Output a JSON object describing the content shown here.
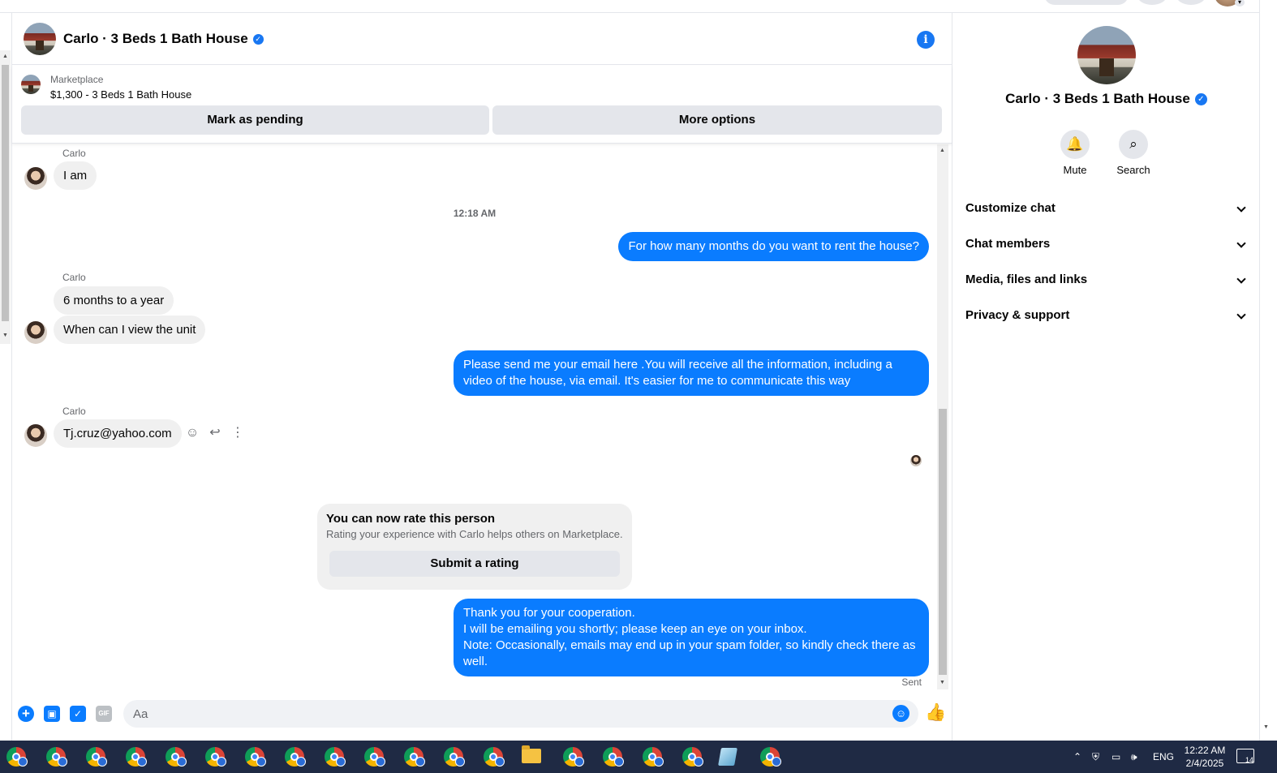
{
  "chat": {
    "title": "Carlo · 3 Beds 1 Bath House",
    "marketplace_label": "Marketplace",
    "listing": "$1,300 - 3 Beds 1 Bath House",
    "mark_pending": "Mark as pending",
    "more_options": "More options"
  },
  "messages": {
    "sender": "Carlo",
    "m1": "I am",
    "time": "12:18 AM",
    "m2": "For how many months do you want to rent the house?",
    "m3": "6 months to a year",
    "m4": "When can I view the unit",
    "m5": "Please send me your email here .You will receive all the information, including a video of the house, via email. It's easier for me to communicate this way",
    "m6": "Tj.cruz@yahoo.com",
    "rate_title": "You can now rate this person",
    "rate_sub": "Rating your experience with Carlo helps others on Marketplace.",
    "rate_button": "Submit a rating",
    "m7_line1": "Thank you for your cooperation.",
    "m7_line2": "I will be emailing you shortly; please keep an eye on your inbox.",
    "m7_line3": "Note: Occasionally, emails may end up in your spam folder, so kindly check there as well.",
    "sent": "Sent"
  },
  "composer": {
    "placeholder": "Aa",
    "gif": "GIF"
  },
  "panel": {
    "name": "Carlo · 3 Beds 1 Bath House",
    "mute": "Mute",
    "search": "Search",
    "rows": [
      "Customize chat",
      "Chat members",
      "Media, files and links",
      "Privacy & support"
    ]
  },
  "taskbar": {
    "lang": "ENG",
    "time": "12:22 AM",
    "date": "2/4/2025",
    "notifications": "14"
  },
  "colors": {
    "accent": "#0a7cff",
    "bubble_in": "#f0f0f0",
    "taskbar": "#1f2a44"
  }
}
